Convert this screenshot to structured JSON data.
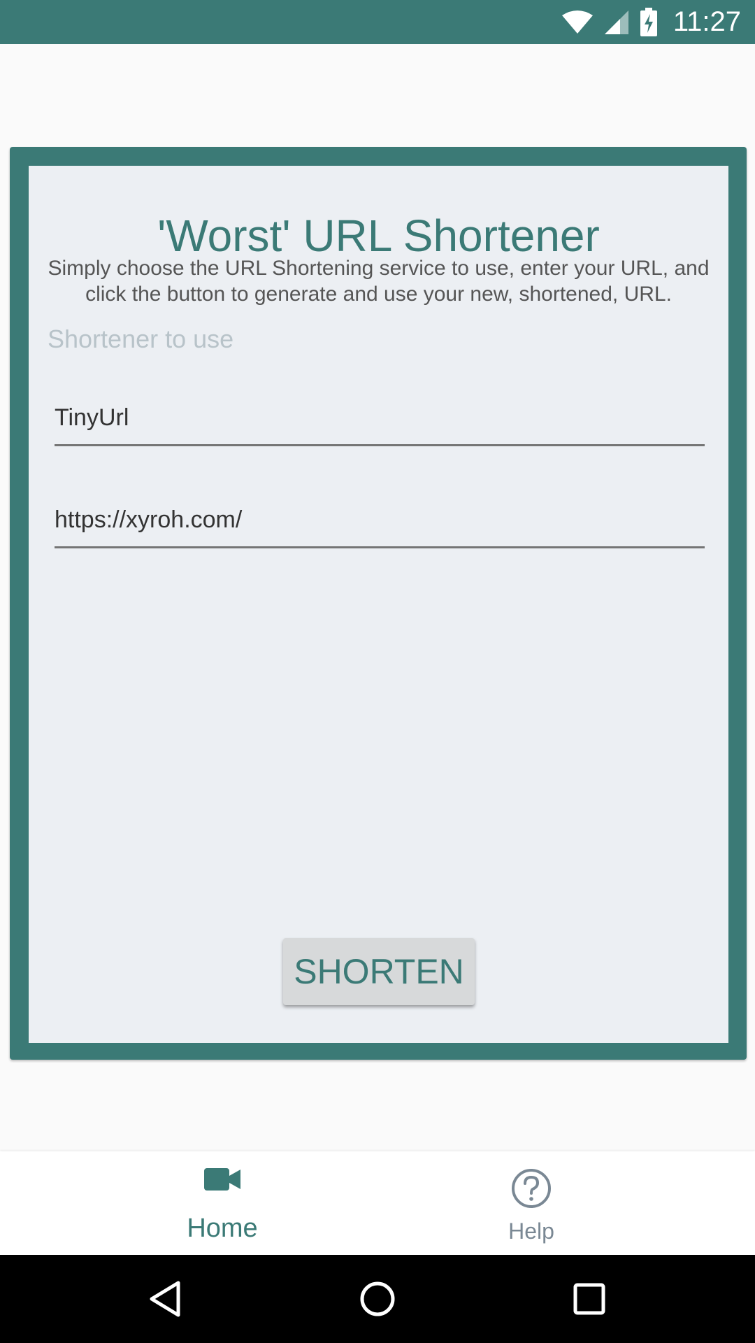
{
  "status_bar": {
    "time": "11:27",
    "icons": [
      "wifi-icon",
      "cell-signal-icon",
      "battery-charging-icon"
    ]
  },
  "app": {
    "title": "'Worst' URL Shortener",
    "description": "Simply choose the URL Shortening service to use, enter your URL, and click the button to generate and use your new, shortened, URL.",
    "shortener_label": "Shortener to use",
    "shortener_selected": "TinyUrl",
    "url_value": "https://xyroh.com/",
    "shorten_button": "SHORTEN"
  },
  "bottom_nav": {
    "items": [
      {
        "label": "Home",
        "icon": "video-camera-icon",
        "active": true
      },
      {
        "label": "Help",
        "icon": "help-circle-icon",
        "active": false
      }
    ]
  },
  "system_nav": {
    "buttons": [
      "back-icon",
      "home-icon",
      "recents-icon"
    ]
  },
  "colors": {
    "primary": "#3b7a76",
    "card_background": "#eceff3",
    "page_background": "#fafafa",
    "inactive_nav": "#7a8894"
  }
}
